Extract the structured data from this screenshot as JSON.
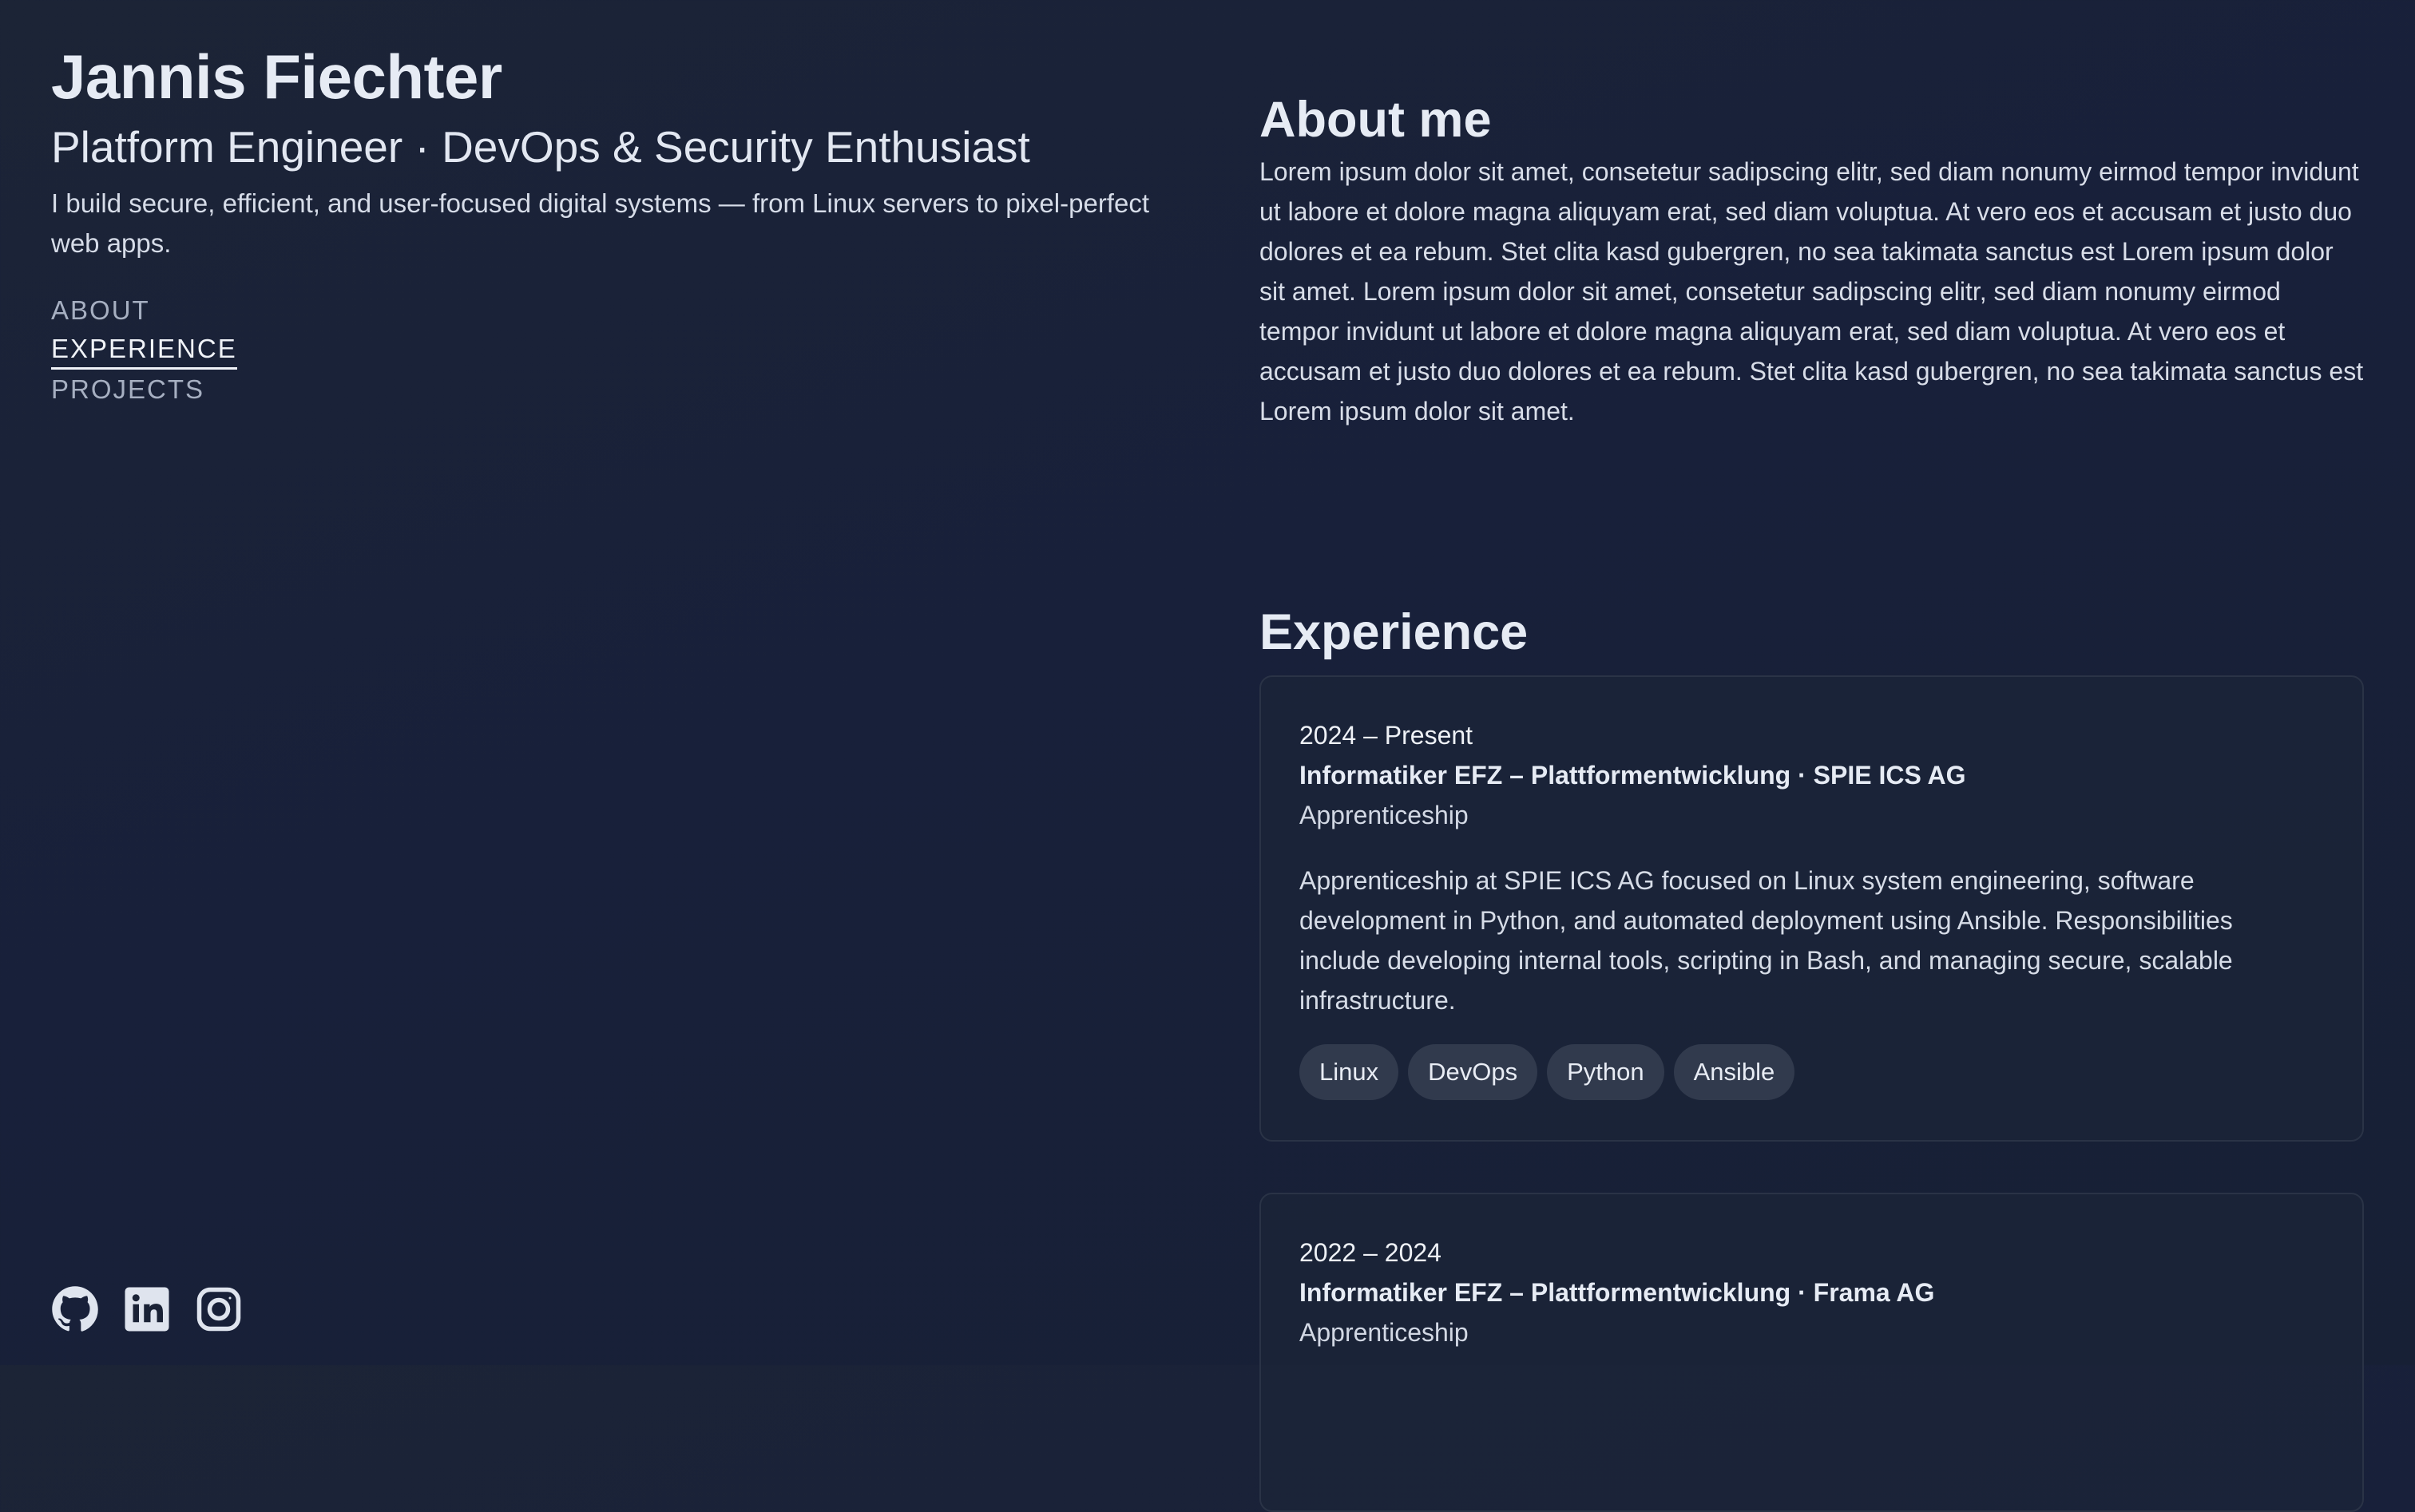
{
  "profile": {
    "name": "Jannis Fiechter",
    "role": "Platform Engineer · DevOps & Security Enthusiast",
    "tagline": "I build secure, efficient, and user-focused digital systems — from Linux servers to pixel-perfect web apps."
  },
  "nav": {
    "items": [
      {
        "label": "ABOUT",
        "active": false
      },
      {
        "label": "EXPERIENCE",
        "active": true
      },
      {
        "label": "PROJECTS",
        "active": false
      }
    ]
  },
  "socials": [
    {
      "icon": "github-icon"
    },
    {
      "icon": "linkedin-icon"
    },
    {
      "icon": "instagram-icon"
    }
  ],
  "about": {
    "title": "About me",
    "text": "Lorem ipsum dolor sit amet, consetetur sadipscing elitr, sed diam nonumy eirmod tempor invidunt ut labore et dolore magna aliquyam erat, sed diam voluptua. At vero eos et accusam et justo duo dolores et ea rebum. Stet clita kasd gubergren, no sea takimata sanctus est Lorem ipsum dolor sit amet. Lorem ipsum dolor sit amet, consetetur sadipscing elitr, sed diam nonumy eirmod tempor invidunt ut labore et dolore magna aliquyam erat, sed diam voluptua. At vero eos et accusam et justo duo dolores et ea rebum. Stet clita kasd gubergren, no sea takimata sanctus est Lorem ipsum dolor sit amet."
  },
  "experience": {
    "title": "Experience",
    "items": [
      {
        "date": "2024 – Present",
        "title": "Informatiker EFZ – Plattformentwicklung · SPIE ICS AG",
        "type": "Apprenticeship",
        "description": "Apprenticeship at SPIE ICS AG focused on Linux system engineering, software development in Python, and automated deployment using Ansible. Responsibilities include developing internal tools, scripting in Bash, and managing secure, scalable infrastructure.",
        "tags": [
          "Linux",
          "DevOps",
          "Python",
          "Ansible"
        ]
      },
      {
        "date": "2022 – 2024",
        "title": "Informatiker EFZ – Plattformentwicklung · Frama AG",
        "type": "Apprenticeship"
      }
    ]
  },
  "colors": {
    "background": "#1a2236",
    "text": "#e6ebf4",
    "muted": "#a6afc1",
    "tag_bg": "#313a4d",
    "card_border": "#2a3346"
  }
}
